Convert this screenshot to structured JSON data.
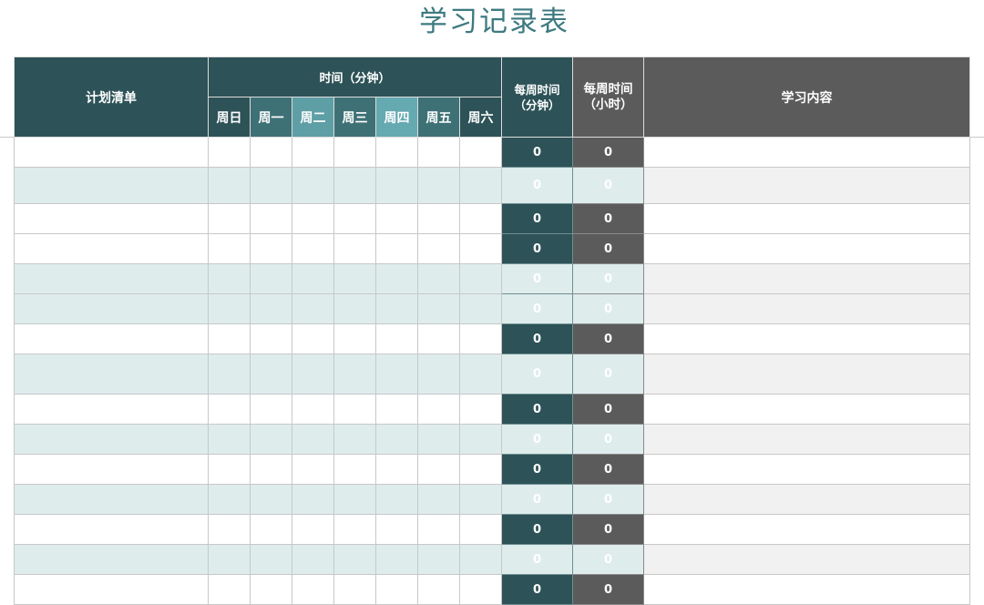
{
  "title": "学习记录表",
  "header": {
    "plan": "计划清单",
    "time_group": "时间（分钟）",
    "days": [
      "周日",
      "周一",
      "周二",
      "周三",
      "周四",
      "周五",
      "周六"
    ],
    "weekly_minutes": "每周时间\n（分钟）",
    "weekly_hours": "每周时间\n（小时）",
    "content": "学习内容"
  },
  "rows": [
    {
      "weekly_minutes": "0",
      "weekly_hours": "0"
    },
    {
      "weekly_minutes": "0",
      "weekly_hours": "0"
    },
    {
      "weekly_minutes": "0",
      "weekly_hours": "0"
    },
    {
      "weekly_minutes": "0",
      "weekly_hours": "0"
    },
    {
      "weekly_minutes": "0",
      "weekly_hours": "0"
    },
    {
      "weekly_minutes": "0",
      "weekly_hours": "0"
    },
    {
      "weekly_minutes": "0",
      "weekly_hours": "0"
    },
    {
      "weekly_minutes": "0",
      "weekly_hours": "0"
    },
    {
      "weekly_minutes": "0",
      "weekly_hours": "0"
    },
    {
      "weekly_minutes": "0",
      "weekly_hours": "0"
    },
    {
      "weekly_minutes": "0",
      "weekly_hours": "0"
    },
    {
      "weekly_minutes": "0",
      "weekly_hours": "0"
    },
    {
      "weekly_minutes": "0",
      "weekly_hours": "0"
    },
    {
      "weekly_minutes": "0",
      "weekly_hours": "0"
    },
    {
      "weekly_minutes": "0",
      "weekly_hours": "0"
    }
  ],
  "colors": {
    "title": "#3d7a80",
    "header_dark_teal": "#2d5257",
    "header_gray": "#5b5b5b",
    "row_alt": "#deecec"
  }
}
